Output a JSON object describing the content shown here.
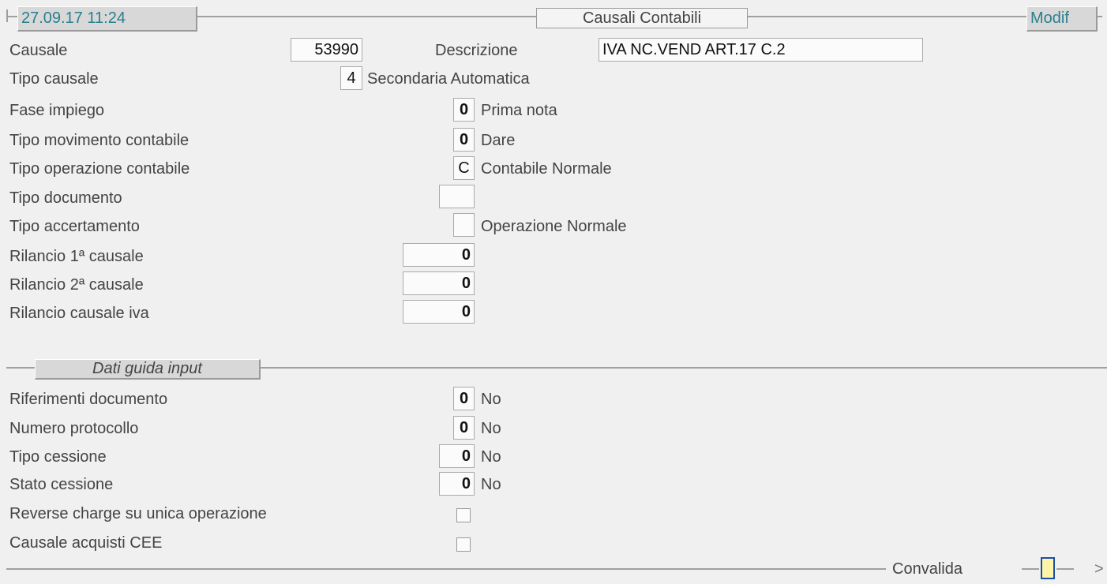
{
  "header": {
    "timestamp": "27.09.17 11:24",
    "title": "Causali Contabili",
    "mode": "Modif"
  },
  "form": {
    "causale": {
      "label": "Causale",
      "value": "53990"
    },
    "descrizione": {
      "label": "Descrizione",
      "value": "IVA NC.VEND ART.17 C.2"
    },
    "tipo_causale": {
      "label": "Tipo causale",
      "value": "4",
      "desc": "Secondaria Automatica"
    },
    "fase_impiego": {
      "label": "Fase impiego",
      "value": "0",
      "desc": "Prima nota"
    },
    "tipo_movimento": {
      "label": "Tipo movimento contabile",
      "value": "0",
      "desc": "Dare"
    },
    "tipo_operazione": {
      "label": "Tipo operazione contabile",
      "value": "C",
      "desc": "Contabile Normale"
    },
    "tipo_documento": {
      "label": "Tipo documento",
      "value": ""
    },
    "tipo_accertamento": {
      "label": "Tipo accertamento",
      "value": "",
      "desc": "Operazione Normale"
    },
    "rilancio_1": {
      "label": "Rilancio 1ª causale",
      "value": "0"
    },
    "rilancio_2": {
      "label": "Rilancio 2ª causale",
      "value": "0"
    },
    "rilancio_iva": {
      "label": "Rilancio causale iva",
      "value": "0"
    }
  },
  "dati_guida": {
    "section_title": "Dati guida input",
    "riferimenti": {
      "label": "Riferimenti documento",
      "value": "0",
      "desc": "No"
    },
    "protocollo": {
      "label": "Numero protocollo",
      "value": "0",
      "desc": "No"
    },
    "tipo_cessione": {
      "label": "Tipo cessione",
      "value": "0",
      "desc": "No"
    },
    "stato_cessione": {
      "label": "Stato cessione",
      "value": "0",
      "desc": "No"
    },
    "reverse_charge": {
      "label": "Reverse charge su unica operazione",
      "checked": false
    },
    "acquisti_cee": {
      "label": "Causale acquisti CEE",
      "checked": false
    }
  },
  "footer": {
    "convalida": "Convalida",
    "more": ">"
  },
  "colors": {
    "background": "#f0f0f0",
    "accent_text": "#2a7f8f",
    "indicator_fill": "#fff5a8",
    "indicator_border": "#1b4fa8"
  }
}
